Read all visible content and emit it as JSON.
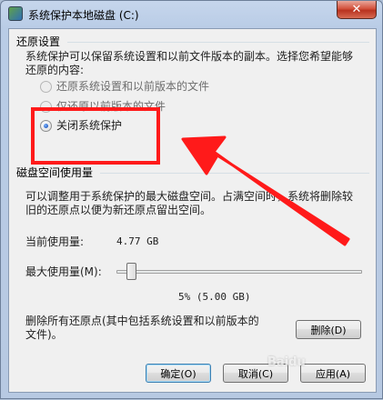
{
  "window": {
    "title": "系统保护本地磁盘 (C:)",
    "close_label": "✕"
  },
  "restore_settings": {
    "heading": "还原设置",
    "description_line1": "系统保护可以保留系统设置和以前文件版本的副本。选择您希望能够",
    "description_line2": "还原的内容:",
    "options": [
      {
        "label": "还原系统设置和以前版本的文件",
        "selected": false,
        "enabled": false
      },
      {
        "label": "仅还原以前版本的文件",
        "selected": false,
        "enabled": false
      },
      {
        "label": "关闭系统保护",
        "selected": true,
        "enabled": true
      }
    ]
  },
  "disk_usage": {
    "heading": "磁盘空间使用量",
    "description_line1": "可以调整用于系统保护的最大磁盘空间。占满空间时，系统将删除较",
    "description_line2": "旧的还原点以便为新还原点留出空间。",
    "current_label": "当前使用量:",
    "current_value": "4.77 GB",
    "max_label": "最大使用量(M):",
    "max_percent": 5,
    "max_value_text": "5% (5.00 GB)"
  },
  "delete_section": {
    "description_line1": "删除所有还原点(其中包括系统设置和以前版本的",
    "description_line2": "文件)。",
    "delete_label": "删除(D)"
  },
  "footer": {
    "ok_label": "确定(O)",
    "cancel_label": "取消(C)",
    "apply_label": "应用(A)"
  },
  "colors": {
    "annotation": "#ff1a1a"
  },
  "watermark_text": "Baidu"
}
